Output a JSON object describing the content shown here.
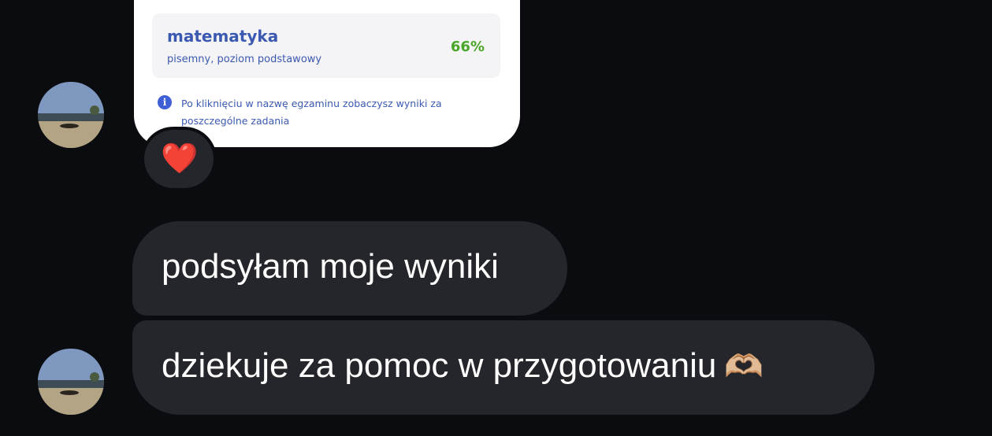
{
  "shared_result_card": {
    "subject": "matematyka",
    "detail": "pisemny, poziom podstawowy",
    "score": "66%",
    "info_icon": "info-icon",
    "info_text": "Po kliknięciu w nazwę egzaminu zobaczysz wyniki za poszczególne zadania"
  },
  "reaction": {
    "emoji": "❤️",
    "icon": "red-heart-icon"
  },
  "messages": [
    {
      "text": "podsyłam moje wyniki"
    },
    {
      "text": "dziekuje za pomoc w przygotowaniu",
      "emoji": "🫶🏼",
      "emoji_icon": "heart-hands-icon"
    }
  ],
  "colors": {
    "background": "#0b0c10",
    "bubble": "#24262b",
    "card_text": "#3b59b0",
    "score": "#4aa628"
  }
}
